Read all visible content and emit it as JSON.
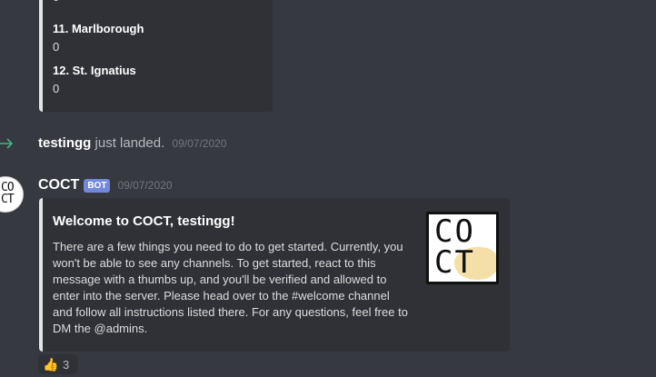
{
  "previous_embed": {
    "fields": [
      {
        "name": "",
        "value": "0"
      },
      {
        "name": "11. Marlborough",
        "value": "0"
      },
      {
        "name": "12. St. Ignatius",
        "value": "0"
      }
    ]
  },
  "join_message": {
    "username": "testingg",
    "text": "just landed.",
    "timestamp": "09/07/2020",
    "icon": "join-arrow-icon",
    "icon_color": "#43b581"
  },
  "bot_message": {
    "username": "COCT",
    "badge": "BOT",
    "timestamp": "09/07/2020",
    "avatar_icon": "coct-logo"
  },
  "embed": {
    "title": "Welcome to COCT, testingg!",
    "description": "There are a few things you need to do to get started. Currently, you won't be able to see any channels. To get started, react to this message with a thumbs up, and you'll be verified and allowed to enter into the server. Please head over to the #welcome channel and follow all instructions listed there. For any questions, feel free to DM the @admins.",
    "thumbnail_icon": "coct-logo",
    "accent_color": "#e3e5e8"
  },
  "reactions": [
    {
      "emoji": "👍",
      "count": "3"
    }
  ],
  "colors": {
    "background": "#36393f",
    "embed_background": "#2f3136",
    "bot_badge": "#7289da"
  }
}
